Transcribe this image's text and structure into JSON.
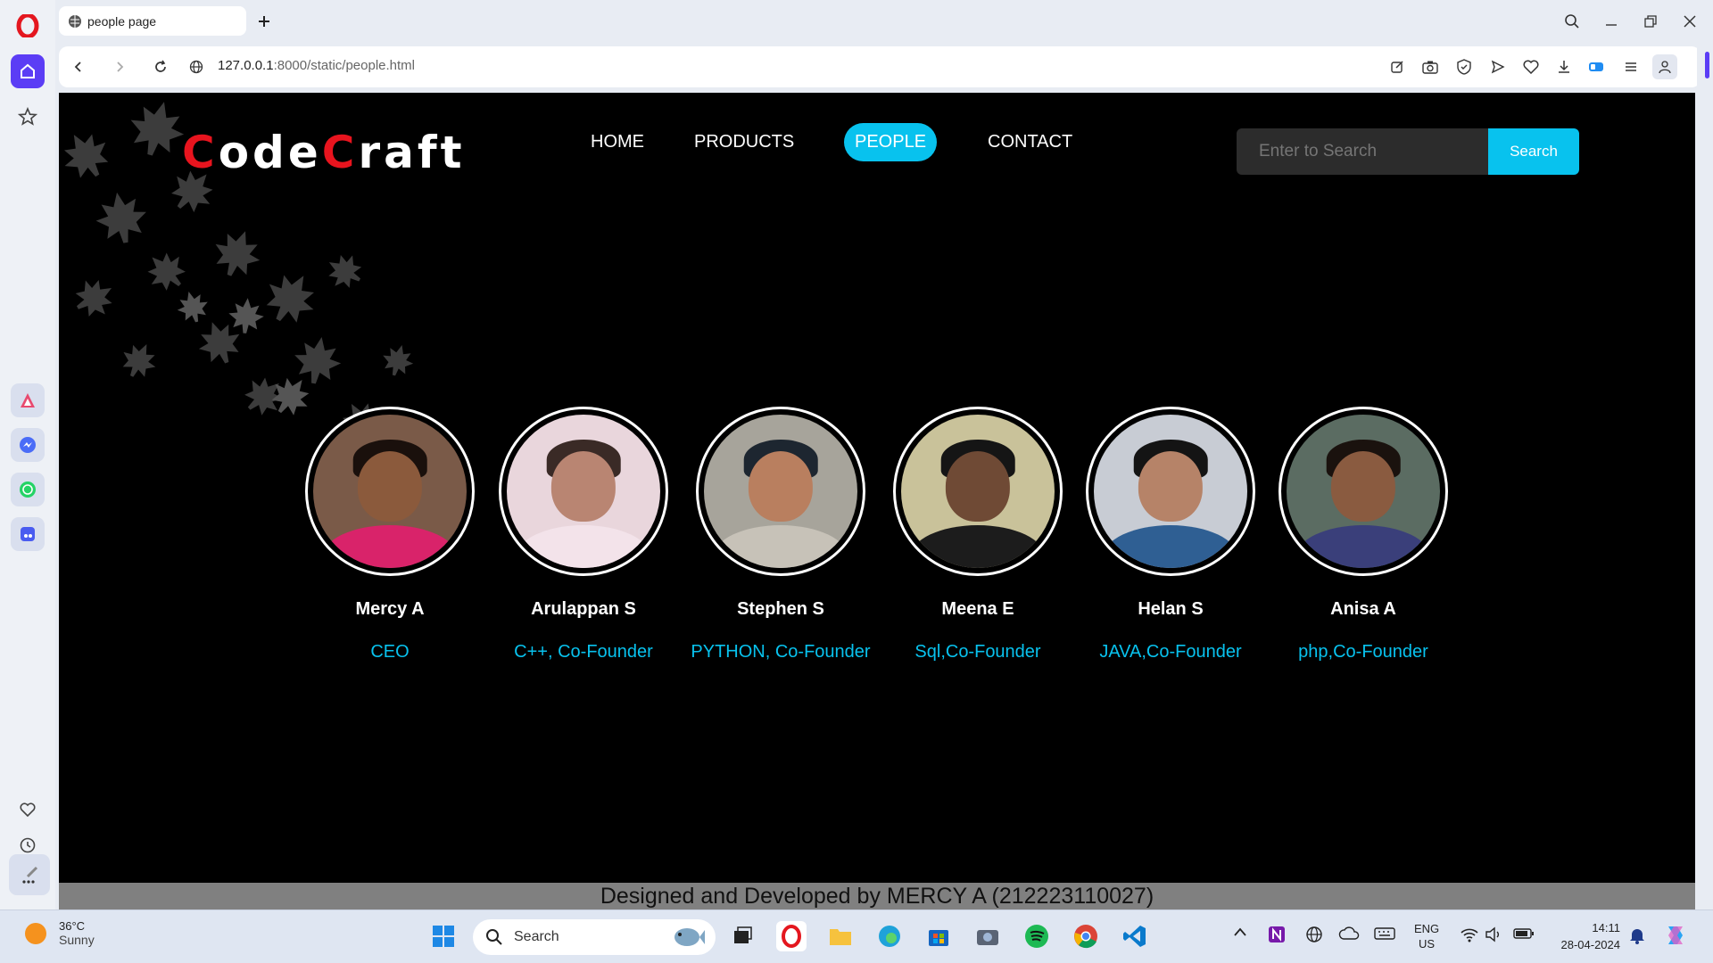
{
  "browser": {
    "tab_title": "people page",
    "url_host": "127.0.0.1",
    "url_rest": ":8000/static/people.html"
  },
  "site": {
    "logo_letters": [
      {
        "text": "C",
        "red": true
      },
      {
        "text": "ode",
        "red": false
      },
      {
        "text": "C",
        "red": true
      },
      {
        "text": "raft",
        "red": false
      }
    ],
    "nav": [
      "HOME",
      "PRODUCTS",
      "PEOPLE",
      "CONTACT"
    ],
    "active_nav": "PEOPLE",
    "search_placeholder": "Enter to Search",
    "search_button": "Search",
    "people": [
      {
        "name": "Mercy A",
        "role": "CEO"
      },
      {
        "name": "Arulappan S",
        "role": "C++, Co-Founder"
      },
      {
        "name": "Stephen S",
        "role": "PYTHON, Co-Founder"
      },
      {
        "name": "Meena E",
        "role": "Sql,Co-Founder"
      },
      {
        "name": "Helan S",
        "role": "JAVA,Co-Founder"
      },
      {
        "name": "Anisa A",
        "role": "php,Co-Founder"
      }
    ],
    "footer": "Designed and Developed by MERCY A (212223110027)"
  },
  "colors": {
    "accent": "#08c2ee",
    "logo_red": "#e8141e",
    "page_bg": "#000000",
    "footer_bg": "#808080",
    "opera_purple": "#5b3df5"
  },
  "taskbar": {
    "temp": "36°C",
    "weather": "Sunny",
    "search": "Search",
    "lang_1": "ENG",
    "lang_2": "US",
    "time": "14:11",
    "date": "28-04-2024"
  }
}
